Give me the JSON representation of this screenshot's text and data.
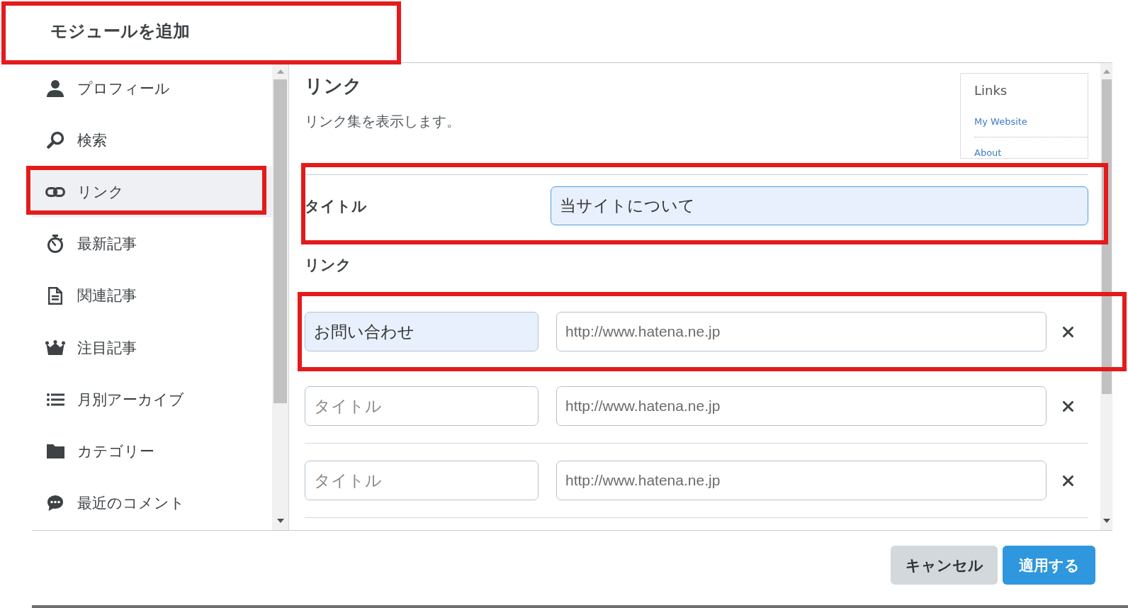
{
  "dialog": {
    "title": "モジュールを追加",
    "highlighted": true
  },
  "sidebar": {
    "items": [
      {
        "label": "プロフィール",
        "selected": false,
        "highlighted": false
      },
      {
        "label": "検索",
        "selected": false,
        "highlighted": false
      },
      {
        "label": "リンク",
        "selected": true,
        "highlighted": true
      },
      {
        "label": "最新記事",
        "selected": false,
        "highlighted": false
      },
      {
        "label": "関連記事",
        "selected": false,
        "highlighted": false
      },
      {
        "label": "注目記事",
        "selected": false,
        "highlighted": false
      },
      {
        "label": "月別アーカイブ",
        "selected": false,
        "highlighted": false
      },
      {
        "label": "カテゴリー",
        "selected": false,
        "highlighted": false
      },
      {
        "label": "最近のコメント",
        "selected": false,
        "highlighted": false
      }
    ]
  },
  "module": {
    "heading": "リンク",
    "description": "リンク集を表示します。",
    "preview": {
      "title": "Links",
      "links": [
        "My Website",
        "About"
      ]
    }
  },
  "title_field": {
    "label": "タイトル",
    "value": "当サイトについて",
    "focused": true,
    "highlighted": true
  },
  "links": {
    "label": "リンク",
    "rows": [
      {
        "title": {
          "value": "お問い合わせ"
        },
        "url": {
          "placeholder": "http://www.hatena.ne.jp"
        },
        "highlighted": true
      },
      {
        "title": {
          "placeholder": "タイトル"
        },
        "url": {
          "placeholder": "http://www.hatena.ne.jp"
        },
        "highlighted": false
      },
      {
        "title": {
          "placeholder": "タイトル"
        },
        "url": {
          "placeholder": "http://www.hatena.ne.jp"
        },
        "highlighted": false
      }
    ]
  },
  "buttons": [
    {
      "label": "キャンセル",
      "kind": "secondary"
    },
    {
      "label": "適用する",
      "kind": "primary"
    }
  ]
}
